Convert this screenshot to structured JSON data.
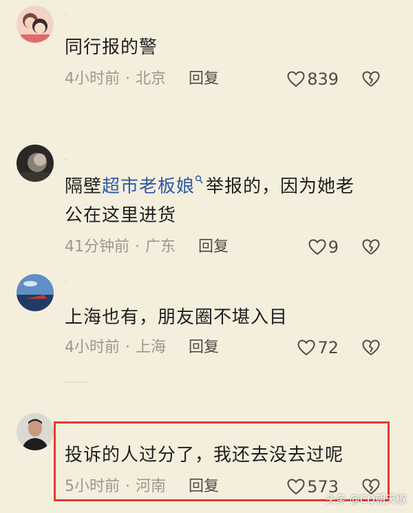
{
  "comments": [
    {
      "text": "同行报的警",
      "time": "4小时前",
      "separator": "·",
      "location": "北京",
      "reply": "回复",
      "likes": "839",
      "avatar_icon": "cartoon-couple-avatar"
    },
    {
      "text_before": "隔壁",
      "text_link": "超市老板娘",
      "text_after": "举报的，因为她老",
      "text_line2": "公在这里进货",
      "time": "41分钟前",
      "separator": "·",
      "location": "广东",
      "reply": "回复",
      "likes": "9",
      "avatar_icon": "dark-photo-avatar"
    },
    {
      "text": "上海也有，朋友圈不堪入目",
      "time": "4小时前",
      "separator": "·",
      "location": "上海",
      "reply": "回复",
      "likes": "72",
      "avatar_icon": "sky-ocean-avatar"
    },
    {
      "text": "投诉的人过分了，我还去没去过呢",
      "time": "5小时前",
      "separator": "·",
      "location": "河南",
      "reply": "回复",
      "likes": "573",
      "avatar_icon": "man-photo-avatar"
    }
  ],
  "watermark": "头条 @CQ朝天椒",
  "colors": {
    "background": "#f4eedd",
    "link": "#2c5aa8",
    "highlight_border": "#e8392c"
  }
}
